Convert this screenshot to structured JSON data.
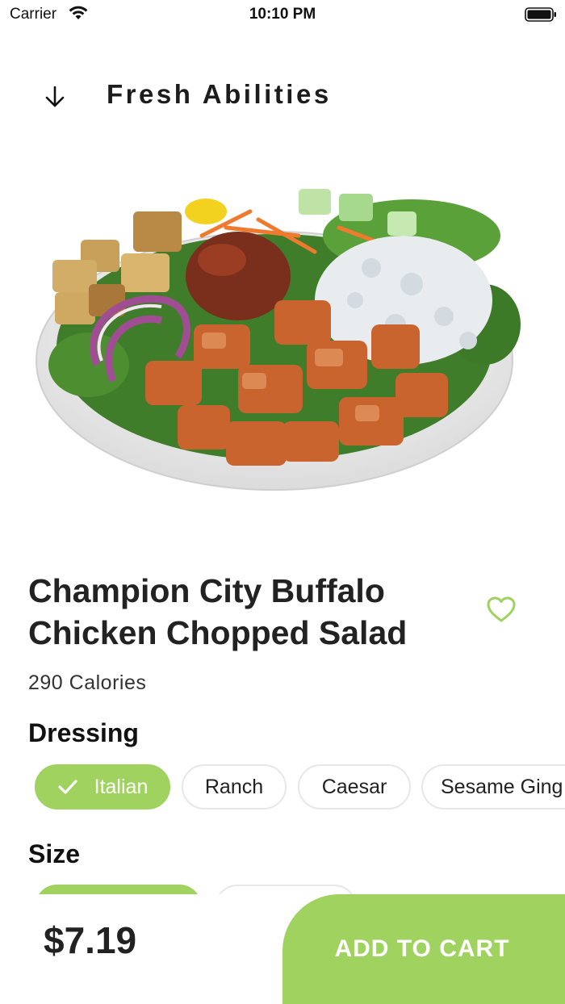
{
  "status_bar": {
    "carrier": "Carrier",
    "time": "10:10 PM"
  },
  "header": {
    "title": "Fresh Abilities",
    "back_icon": "arrow-down-icon"
  },
  "product": {
    "name": "Champion City Buffalo Chicken Chopped Salad",
    "calories": "290 Calories",
    "image": "salad-bowl-photo",
    "favorite_icon": "heart-outline-icon"
  },
  "options": {
    "dressing": {
      "label": "Dressing",
      "choices": [
        "Italian",
        "Ranch",
        "Caesar",
        "Sesame Ging"
      ],
      "selected": "Italian"
    },
    "size": {
      "label": "Size"
    }
  },
  "footer": {
    "price": "$7.19",
    "add_to_cart_label": "ADD TO CART"
  },
  "colors": {
    "accent": "#9fd25f",
    "text": "#222222",
    "chip_border": "#e7e7e7"
  }
}
